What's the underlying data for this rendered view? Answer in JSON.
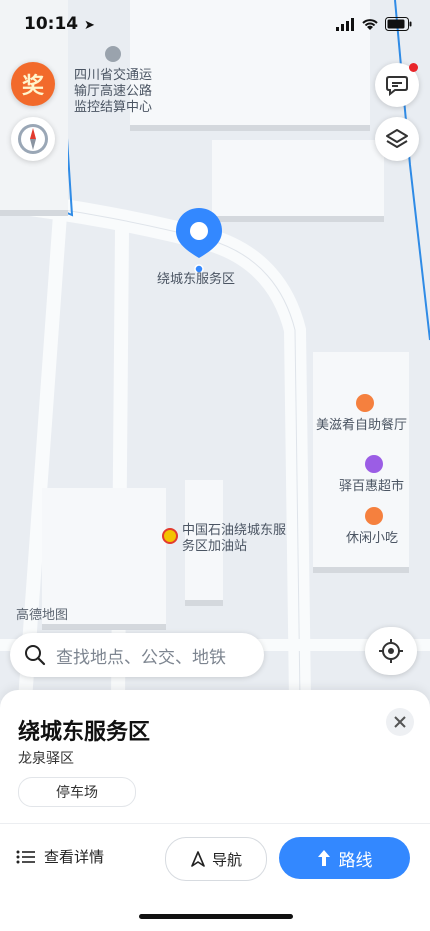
{
  "status_bar": {
    "time": "10:14"
  },
  "map": {
    "attribution": "高德地图",
    "pois": {
      "transport_office": "四川省交通运输厅高速公路监控结算中心",
      "selected_place": "绕城东服务区",
      "restaurant": "美滋肴自助餐厅",
      "supermarket": "驿百惠超市",
      "snack": "休闲小吃",
      "gas_station": "中国石油绕城东服务区加油站"
    },
    "prize_badge": "奖"
  },
  "search": {
    "placeholder": "查找地点、公交、地铁"
  },
  "sheet": {
    "title": "绕城东服务区",
    "district": "龙泉驿区",
    "tag": "停车场",
    "details_label": "查看详情",
    "navigate_label": "导航",
    "route_label": "路线"
  },
  "colors": {
    "accent": "#3388ff",
    "poi_orange": "#f5803e",
    "poi_purple": "#9b5de5",
    "route_line": "#2f8be6"
  }
}
